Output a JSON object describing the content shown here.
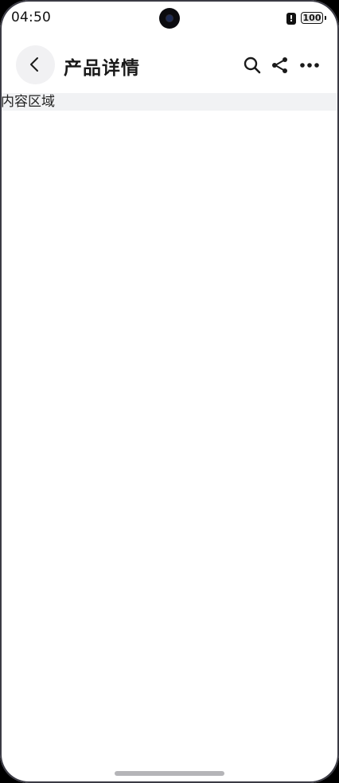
{
  "status_bar": {
    "time": "04:50",
    "alert_glyph": "!",
    "battery_level": "100",
    "icons": [
      "front-camera",
      "alert-icon",
      "battery-icon"
    ]
  },
  "header": {
    "title": "产品详情",
    "icons": [
      "back-chevron-icon",
      "search-icon",
      "share-icon",
      "more-icon"
    ]
  },
  "content": {
    "label": "内容区域"
  },
  "colors": {
    "background": "#ffffff",
    "content_area": "#f1f2f4",
    "back_button_bg": "#f1f1f3",
    "text": "#1a1a1a",
    "home_indicator": "#b5b5b8"
  }
}
